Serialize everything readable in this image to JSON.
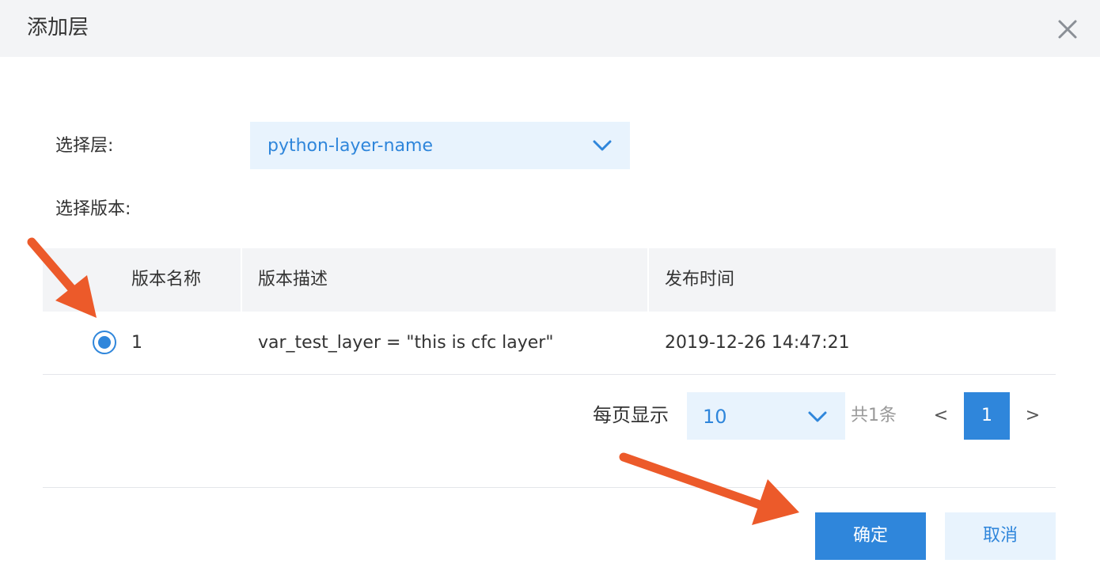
{
  "dialog": {
    "title": "添加层"
  },
  "form": {
    "layer_label": "选择层:",
    "layer_value": "python-layer-name",
    "version_label": "选择版本:"
  },
  "table": {
    "headers": [
      "版本名称",
      "版本描述",
      "发布时间"
    ],
    "rows": [
      {
        "selected": true,
        "name": "1",
        "description": "var_test_layer = \"this is cfc layer\"",
        "published": "2019-12-26 14:47:21"
      }
    ]
  },
  "pagination": {
    "page_size_label": "每页显示",
    "page_size": "10",
    "total": "共1条",
    "prev": "<",
    "current_page": "1",
    "next": ">"
  },
  "buttons": {
    "confirm": "确定",
    "cancel": "取消"
  },
  "colors": {
    "accent": "#2f86db",
    "select_bg": "#e8f3fd",
    "header_bg": "#f3f4f6",
    "annotation_arrow": "#ec5a2a"
  }
}
